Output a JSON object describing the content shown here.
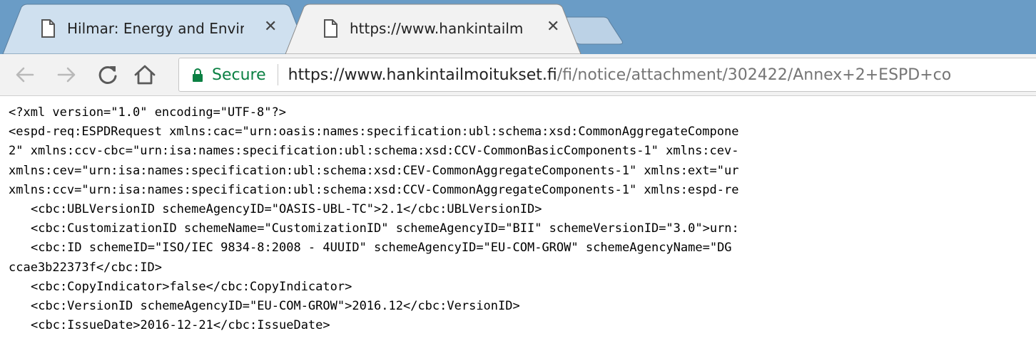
{
  "tabs": [
    {
      "title": "Hilmar: Energy and Envir",
      "active": false
    },
    {
      "title": "https://www.hankintailm",
      "active": true
    }
  ],
  "close_glyph": "✕",
  "toolbar": {
    "back_icon": "back-arrow-icon",
    "forward_icon": "forward-arrow-icon",
    "reload_icon": "reload-icon",
    "home_icon": "home-icon"
  },
  "omnibox": {
    "secure_label": "Secure",
    "url_host": "https://www.hankintailmoitukset.fi",
    "url_path": "/fi/notice/attachment/302422/Annex+2+ESPD+co"
  },
  "colors": {
    "tabstrip": "#6a9cc6",
    "inactive_tab": "#cfe0ef",
    "active_tab": "#f2f2f2",
    "secure_green": "#0b8043"
  },
  "xml_lines": [
    "<?xml version=\"1.0\" encoding=\"UTF-8\"?>",
    "<espd-req:ESPDRequest xmlns:cac=\"urn:oasis:names:specification:ubl:schema:xsd:CommonAggregateCompone",
    "2\" xmlns:ccv-cbc=\"urn:isa:names:specification:ubl:schema:xsd:CCV-CommonBasicComponents-1\" xmlns:cev-",
    "xmlns:cev=\"urn:isa:names:specification:ubl:schema:xsd:CEV-CommonAggregateComponents-1\" xmlns:ext=\"ur",
    "xmlns:ccv=\"urn:isa:names:specification:ubl:schema:xsd:CCV-CommonAggregateComponents-1\" xmlns:espd-re",
    "<cbc:UBLVersionID schemeAgencyID=\"OASIS-UBL-TC\">2.1</cbc:UBLVersionID>",
    "<cbc:CustomizationID schemeName=\"CustomizationID\" schemeAgencyID=\"BII\" schemeVersionID=\"3.0\">urn:",
    "<cbc:ID schemeID=\"ISO/IEC 9834-8:2008 - 4UUID\" schemeAgencyID=\"EU-COM-GROW\" schemeAgencyName=\"DG",
    "ccae3b22373f</cbc:ID>",
    "<cbc:CopyIndicator>false</cbc:CopyIndicator>",
    "<cbc:VersionID schemeAgencyID=\"EU-COM-GROW\">2016.12</cbc:VersionID>",
    "<cbc:IssueDate>2016-12-21</cbc:IssueDate>"
  ]
}
